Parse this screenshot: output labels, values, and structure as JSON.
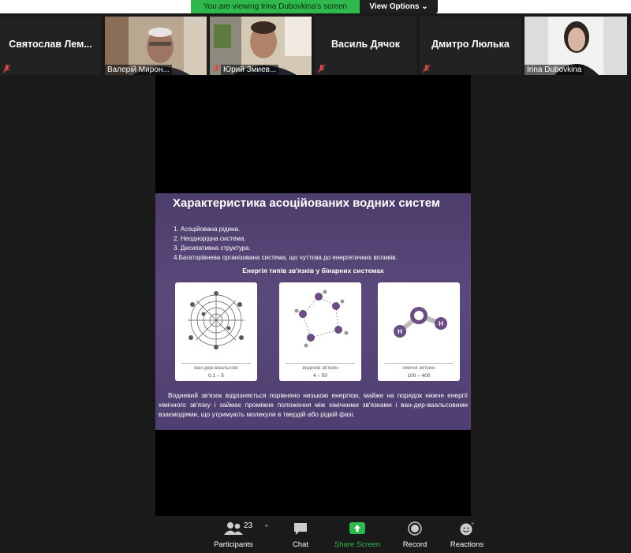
{
  "banner": {
    "viewing_text": "You are viewing Irina Dubovkina's screen",
    "view_options_label": "View Options"
  },
  "participants_strip": [
    {
      "name": "Святослав Лем...",
      "video": false,
      "muted": true
    },
    {
      "name": "Валерій Мирон...",
      "video": true,
      "muted": false
    },
    {
      "name": "Юрий Змиев...",
      "video": true,
      "muted": true
    },
    {
      "name": "Василь Дячок",
      "video": false,
      "muted": true
    },
    {
      "name": "Дмитро Люлька",
      "video": false,
      "muted": true
    },
    {
      "name": "Irina Dubovkina",
      "video": true,
      "muted": false,
      "active_speaker": true
    }
  ],
  "slide": {
    "title": "Характеристика  асоційованих водних систем",
    "list": [
      "1. Асоційована рідина.",
      "2. Неоднорідна система.",
      "3. Дисипативна структура.",
      "4.Багаторівнева організована система, що чуттєва до енергетичних впливів."
    ],
    "subtitle": "Енергія типів зв'язків у бінарних системах",
    "panels": [
      {
        "label": "ван-дер-ваальсові",
        "value": "0,1 – 5"
      },
      {
        "label": "водневі зв'язки",
        "value": "4 – 50"
      },
      {
        "label": "хімічні зв'язки",
        "value": "100 – 400"
      }
    ],
    "paragraph": "Водневий зв'язок відрізняється порівняно низькою енергією, майже на порядок нижче енергії хімічного зв'язку і займає проміжне положення між хімічними зв'язками і ван-дер-ваальсовими взаємодіями, що утримують молекули в твердій або рідкій фазі."
  },
  "toolbar": {
    "participants_label": "Participants",
    "participants_count": "23",
    "chat_label": "Chat",
    "share_label": "Share Screen",
    "record_label": "Record",
    "reactions_label": "Reactions"
  },
  "colors": {
    "share_green": "#2fb84c",
    "slide_purple": "#4d3d6c",
    "active_speaker": "#b7d66b"
  }
}
